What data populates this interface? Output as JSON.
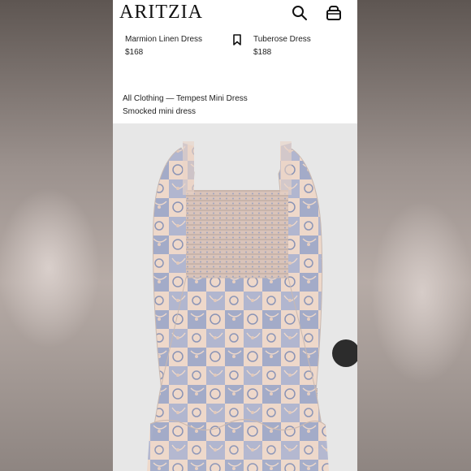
{
  "header": {
    "brand": "ARITZIA",
    "search_icon": "search-icon",
    "bag_icon": "shopping-bag-icon"
  },
  "recommendations": [
    {
      "name": "Marmion Linen Dress",
      "price": "$168"
    },
    {
      "name": "Tuberose Dress",
      "price": "$188"
    }
  ],
  "product": {
    "breadcrumb": "All Clothing — Tempest Mini Dress",
    "subtitle": "Smocked mini dress",
    "image_icon": "dress-image"
  },
  "colors": {
    "background": "#ffffff",
    "image_bg": "#e7e7e7",
    "dress_cream": "#efd9cc",
    "dress_blue": "#9da6c4"
  }
}
